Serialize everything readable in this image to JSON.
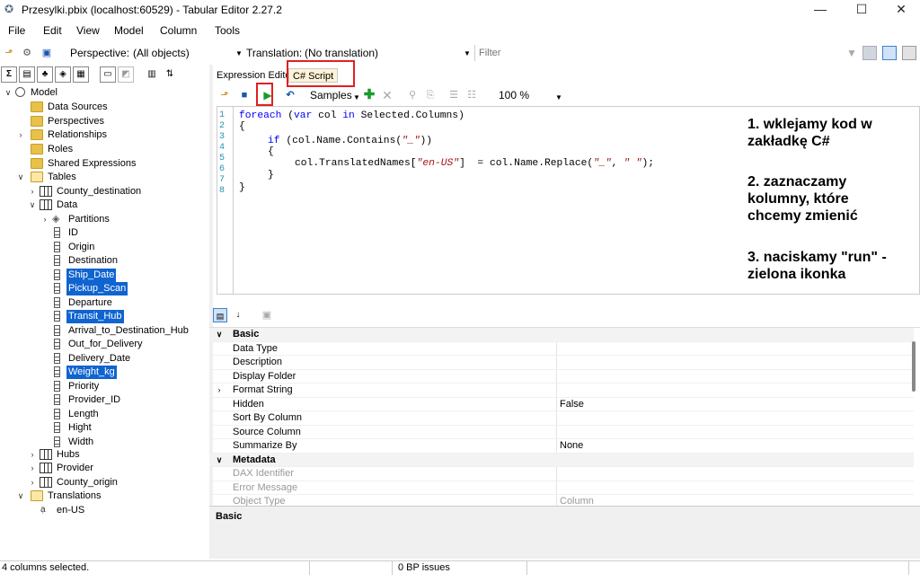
{
  "window": {
    "title": "Przesylki.pbix (localhost:60529) - Tabular Editor 2.27.2",
    "minimize": "—",
    "maximize": "☐",
    "close": "✕"
  },
  "menu": [
    "File",
    "Edit",
    "View",
    "Model",
    "Column",
    "Tools"
  ],
  "toolbar": {
    "perspective_label": "Perspective:",
    "perspective_value": "(All objects)",
    "translation_label": "Translation:",
    "translation_value": "(No translation)",
    "filter_placeholder": "Filter"
  },
  "tabs": {
    "expression_editor": "Expression Editor",
    "csharp_script": "C# Script"
  },
  "script_toolbar": {
    "samples": "Samples",
    "zoom": "100 %"
  },
  "tree": {
    "model": "Model",
    "data_sources": "Data Sources",
    "perspectives": "Perspectives",
    "relationships": "Relationships",
    "roles": "Roles",
    "shared_expressions": "Shared Expressions",
    "tables": "Tables",
    "county_destination": "County_destination",
    "data": "Data",
    "partitions": "Partitions",
    "columns": [
      "ID",
      "Origin",
      "Destination",
      "Ship_Date",
      "Pickup_Scan",
      "Departure",
      "Transit_Hub",
      "Arrival_to_Destination_Hub",
      "Out_for_Delivery",
      "Delivery_Date",
      "Weight_kg",
      "Priority",
      "Provider_ID",
      "Length",
      "Hight",
      "Width"
    ],
    "hubs": "Hubs",
    "provider": "Provider",
    "county_origin": "County_origin",
    "translations": "Translations",
    "en_us": "en-US"
  },
  "code": {
    "line_numbers": [
      "1",
      "2",
      "3",
      "4",
      "5",
      "6",
      "7",
      "8"
    ],
    "l1_kw1": "foreach",
    "l1_a": " (",
    "l1_kw2": "var",
    "l1_b": " col ",
    "l1_kw3": "in",
    "l1_c": " Selected.Columns)",
    "l2": "{",
    "l3_kw": "if",
    "l3_a": " (col.Name.Contains(",
    "l3_str": "\"_\"",
    "l3_b": "))",
    "l4": "{",
    "l5_a": "col.TranslatedNames[",
    "l5_str": "\"en-US\"",
    "l5_b": "]  = col.Name.Replace(",
    "l5_str2": "\"_\"",
    "l5_c": ", ",
    "l5_str3": "\" \"",
    "l5_d": ");",
    "l6": "}",
    "l7": "}"
  },
  "annotations": {
    "n1a": "1. wklejamy kod w",
    "n1b": "zakładkę C#",
    "n2a": "2. zaznaczamy",
    "n2b": "kolumny, które",
    "n2c": "chcemy zmienić",
    "n3a": "3. naciskamy \"run\" -",
    "n3b": "zielona ikonka"
  },
  "properties": {
    "basic": "Basic",
    "data_type": "Data Type",
    "description": "Description",
    "display_folder": "Display Folder",
    "format_string": "Format String",
    "hidden": "Hidden",
    "hidden_value": "False",
    "sort_by_column": "Sort By Column",
    "source_column": "Source Column",
    "summarize_by": "Summarize By",
    "summarize_by_value": "None",
    "metadata": "Metadata",
    "dax_identifier": "DAX Identifier",
    "error_message": "Error Message",
    "object_type": "Object Type",
    "object_type_value": "Column"
  },
  "description_pane": {
    "title": "Basic"
  },
  "status": {
    "selection": "4 columns selected.",
    "bp_issues": "0 BP issues"
  }
}
